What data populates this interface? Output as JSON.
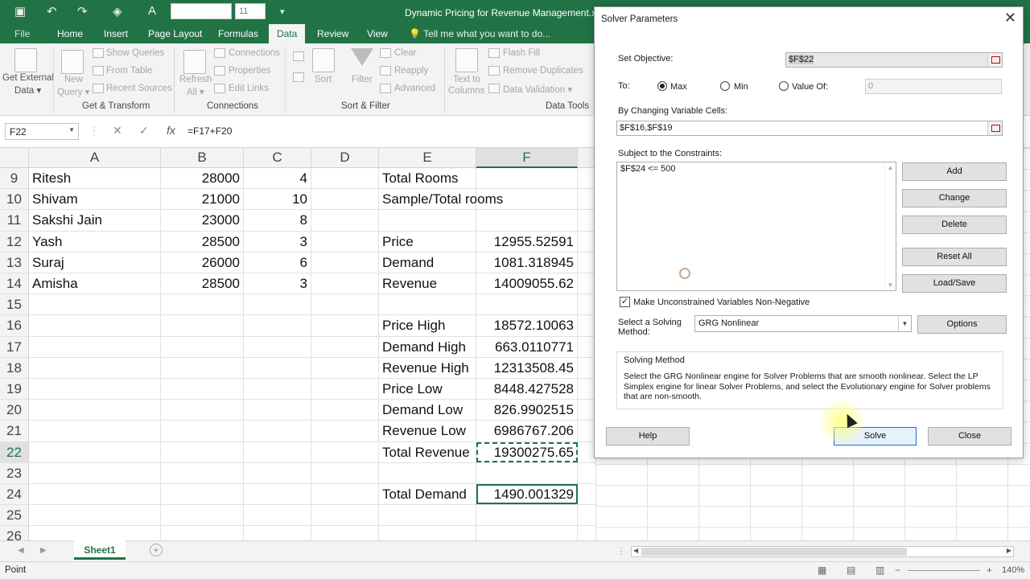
{
  "window": {
    "title": "Dynamic Pricing for Revenue Management.xlsx",
    "font_size_value": "11"
  },
  "tabs": [
    {
      "label": "File"
    },
    {
      "label": "Home"
    },
    {
      "label": "Insert"
    },
    {
      "label": "Page Layout"
    },
    {
      "label": "Formulas"
    },
    {
      "label": "Data"
    },
    {
      "label": "Review"
    },
    {
      "label": "View"
    }
  ],
  "tell_me": "Tell me what you want to do...",
  "ribbon": {
    "get_external_data": "Get External",
    "get_external_data2": "Data ▾",
    "new_query": "New",
    "new_query2": "Query ▾",
    "show_queries": "Show Queries",
    "from_table": "From Table",
    "recent_sources": "Recent Sources",
    "get_transform": "Get & Transform",
    "refresh_all": "Refresh",
    "refresh_all2": "All ▾",
    "connections": "Connections",
    "properties": "Properties",
    "edit_links": "Edit Links",
    "connections_group": "Connections",
    "sort": "Sort",
    "filter": "Filter",
    "clear": "Clear",
    "reapply": "Reapply",
    "advanced": "Advanced",
    "sort_filter_group": "Sort & Filter",
    "text_to_columns": "Text to",
    "text_to_columns2": "Columns",
    "flash_fill": "Flash Fill",
    "remove_duplicates": "Remove Duplicates",
    "data_validation": "Data Validation ▾",
    "data_tools_group": "Data Tools"
  },
  "formula_bar": {
    "name_box": "F22",
    "formula": "=F17+F20"
  },
  "columns": [
    "A",
    "B",
    "C",
    "D",
    "E",
    "F"
  ],
  "rows": [
    {
      "n": "9",
      "a": "Ritesh",
      "b": "28000",
      "c": "4",
      "e": "Total Rooms",
      "f": ""
    },
    {
      "n": "10",
      "a": "Shivam",
      "b": "21000",
      "c": "10",
      "e": "Sample/Total rooms",
      "f": ""
    },
    {
      "n": "11",
      "a": "Sakshi Jain",
      "b": "23000",
      "c": "8",
      "e": "",
      "f": ""
    },
    {
      "n": "12",
      "a": "Yash",
      "b": "28500",
      "c": "3",
      "e": "Price",
      "f": "12955.52591"
    },
    {
      "n": "13",
      "a": "Suraj",
      "b": "26000",
      "c": "6",
      "e": "Demand",
      "f": "1081.318945"
    },
    {
      "n": "14",
      "a": "Amisha",
      "b": "28500",
      "c": "3",
      "e": "Revenue",
      "f": "14009055.62"
    },
    {
      "n": "15",
      "a": "",
      "b": "",
      "c": "",
      "e": "",
      "f": ""
    },
    {
      "n": "16",
      "a": "",
      "b": "",
      "c": "",
      "e": "Price High",
      "f": "18572.10063"
    },
    {
      "n": "17",
      "a": "",
      "b": "",
      "c": "",
      "e": "Demand High",
      "f": "663.0110771"
    },
    {
      "n": "18",
      "a": "",
      "b": "",
      "c": "",
      "e": "Revenue High",
      "f": "12313508.45"
    },
    {
      "n": "19",
      "a": "",
      "b": "",
      "c": "",
      "e": "Price Low",
      "f": "8448.427528"
    },
    {
      "n": "20",
      "a": "",
      "b": "",
      "c": "",
      "e": "Demand Low",
      "f": "826.9902515"
    },
    {
      "n": "21",
      "a": "",
      "b": "",
      "c": "",
      "e": "Revenue Low",
      "f": "6986767.206"
    },
    {
      "n": "22",
      "a": "",
      "b": "",
      "c": "",
      "e": "Total Revenue",
      "f": "19300275.65"
    },
    {
      "n": "23",
      "a": "",
      "b": "",
      "c": "",
      "e": "",
      "f": ""
    },
    {
      "n": "24",
      "a": "",
      "b": "",
      "c": "",
      "e": "Total Demand",
      "f": "1490.001329"
    },
    {
      "n": "25",
      "a": "",
      "b": "",
      "c": "",
      "e": "",
      "f": ""
    },
    {
      "n": "26",
      "a": "",
      "b": "",
      "c": "",
      "e": "",
      "f": ""
    }
  ],
  "sheet_tab": "Sheet1",
  "status": {
    "mode": "Point",
    "zoom": "140%"
  },
  "dialog": {
    "title": "Solver Parameters",
    "set_objective_label": "Set Objective:",
    "set_objective_value": "$F$22",
    "to_label": "To:",
    "max_label": "Max",
    "min_label": "Min",
    "value_of_label": "Value Of:",
    "value_of_value": "0",
    "changing_cells_label": "By Changing Variable Cells:",
    "changing_cells_value": "$F$16,$F$19",
    "constraints_label": "Subject to the Constraints:",
    "constraints": [
      "$F$24 <= 500"
    ],
    "add_btn": "Add",
    "change_btn": "Change",
    "delete_btn": "Delete",
    "reset_btn": "Reset All",
    "load_save_btn": "Load/Save",
    "nonneg_label": "Make Unconstrained Variables Non-Negative",
    "nonneg_checked": true,
    "method_label": "Select a Solving",
    "method_label2": "Method:",
    "method_value": "GRG Nonlinear",
    "options_btn": "Options",
    "method_box_title": "Solving Method",
    "method_box_text": "Select the GRG Nonlinear engine for Solver Problems that are smooth nonlinear. Select the LP Simplex engine for linear Solver Problems, and select the Evolutionary engine for Solver problems that are non-smooth.",
    "help_btn": "Help",
    "solve_btn": "Solve",
    "close_btn": "Close"
  }
}
